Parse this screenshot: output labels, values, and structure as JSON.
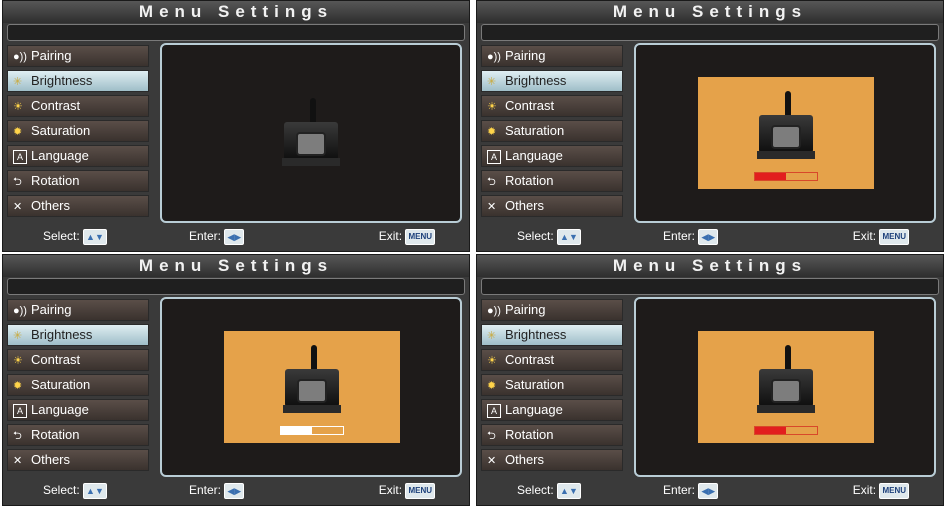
{
  "title": "Menu Settings",
  "menu": [
    {
      "icon": "pairing-icon",
      "glyph": "●))",
      "label": "Pairing"
    },
    {
      "icon": "brightness-icon",
      "glyph": "✳",
      "label": "Brightness"
    },
    {
      "icon": "contrast-icon",
      "glyph": "☀",
      "label": "Contrast"
    },
    {
      "icon": "saturation-icon",
      "glyph": "✹",
      "label": "Saturation"
    },
    {
      "icon": "language-icon",
      "glyph": "A",
      "label": "Language"
    },
    {
      "icon": "rotation-icon",
      "glyph": "⮌",
      "label": "Rotation"
    },
    {
      "icon": "tools-icon",
      "glyph": "✕",
      "label": "Others"
    }
  ],
  "footer": {
    "select_label": "Select:",
    "enter_label": "Enter:",
    "exit_label": "Exit:",
    "select_key": "▲▼",
    "enter_key": "◀▶",
    "exit_key": "MENU"
  },
  "panels": [
    {
      "active_item": "Brightness",
      "preview": "camera",
      "level": null
    },
    {
      "active_item": "Brightness",
      "preview": "orange-screen",
      "level": 0.5,
      "level_color": "#e21e1e"
    },
    {
      "active_item": "Brightness",
      "preview": "orange-screen",
      "level": 0.5,
      "level_color": "#ffffff"
    },
    {
      "active_item": "Brightness",
      "preview": "orange-screen",
      "level": 0.5,
      "level_color": "#e21e1e"
    }
  ],
  "colors": {
    "accent": "#e5a24a",
    "active_item": "#b7d3dc",
    "border": "#b9cdd6"
  }
}
